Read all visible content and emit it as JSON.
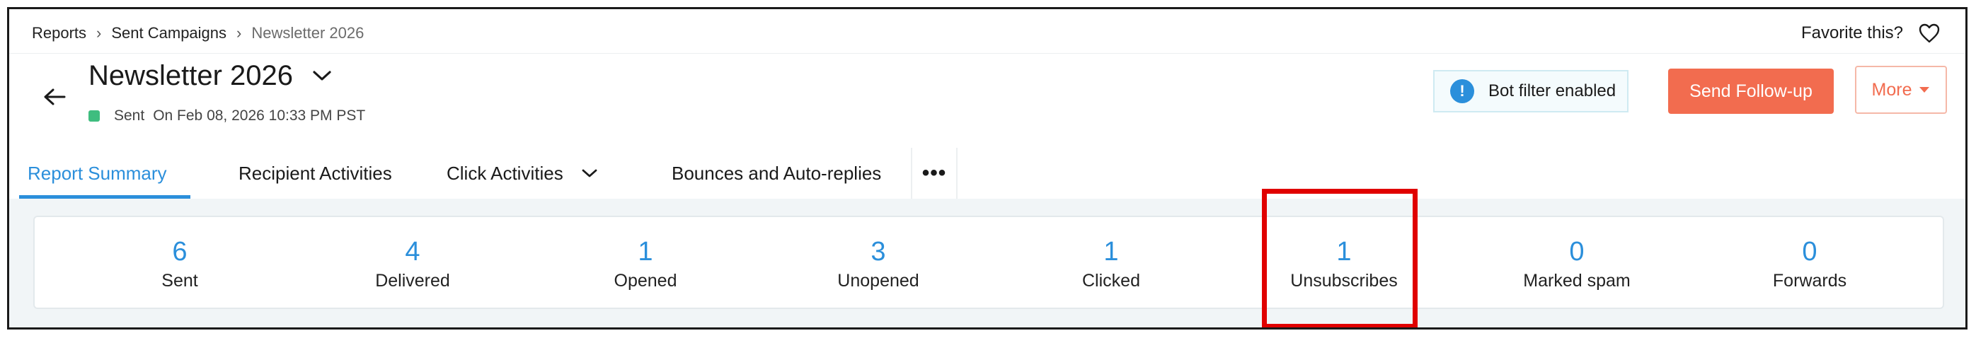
{
  "breadcrumb": {
    "items": [
      "Reports",
      "Sent Campaigns"
    ],
    "current": "Newsletter 2026"
  },
  "favorite": {
    "label": "Favorite this?",
    "icon": "heart-icon"
  },
  "campaign": {
    "title": "Newsletter 2026",
    "status_word": "Sent",
    "sent_on": "On Feb 08, 2026 10:33 PM PST",
    "status_color": "#3fbd7f"
  },
  "toolbar": {
    "bot_filter_label": "Bot filter enabled",
    "follow_up_label": "Send Follow-up",
    "more_label": "More"
  },
  "tabs": [
    {
      "label": "Report Summary",
      "active": true
    },
    {
      "label": "Recipient Activities"
    },
    {
      "label": "Click Activities"
    },
    {
      "label": "Bounces and Auto-replies"
    },
    {
      "label": "•••"
    }
  ],
  "stats": [
    {
      "value": "6",
      "label": "Sent"
    },
    {
      "value": "4",
      "label": "Delivered"
    },
    {
      "value": "1",
      "label": "Opened"
    },
    {
      "value": "3",
      "label": "Unopened"
    },
    {
      "value": "1",
      "label": "Clicked"
    },
    {
      "value": "1",
      "label": "Unsubscribes"
    },
    {
      "value": "0",
      "label": "Marked spam"
    },
    {
      "value": "0",
      "label": "Forwards"
    }
  ],
  "colors": {
    "accent": "#2b8fdb",
    "primary_button": "#f26c4f",
    "highlight": "#e00000"
  }
}
